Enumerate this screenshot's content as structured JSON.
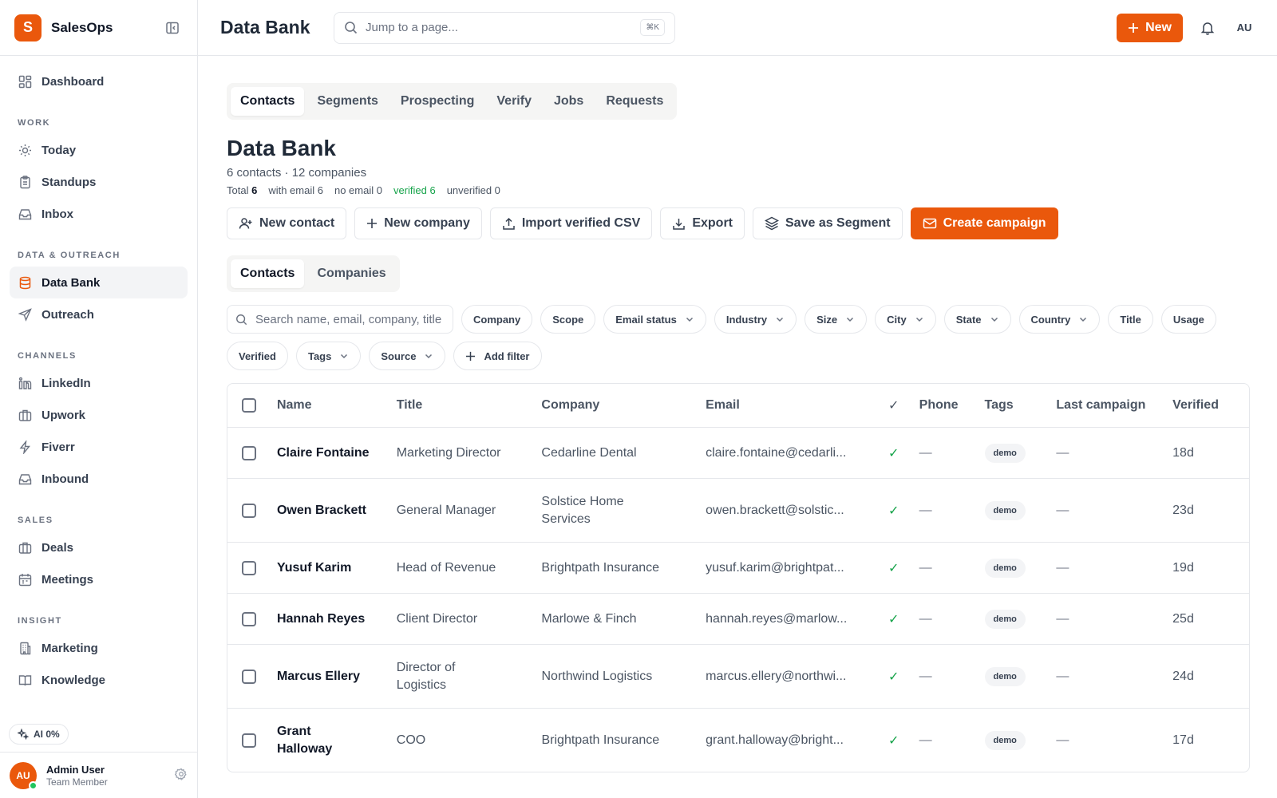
{
  "brand": {
    "logo_letter": "S",
    "name": "SalesOps"
  },
  "sidebar": {
    "top": [
      {
        "label": "Dashboard",
        "icon": "dashboard-icon"
      }
    ],
    "sections": [
      {
        "title": "WORK",
        "items": [
          {
            "label": "Today",
            "icon": "sun-icon"
          },
          {
            "label": "Standups",
            "icon": "clipboard-icon"
          },
          {
            "label": "Inbox",
            "icon": "inbox-icon"
          }
        ]
      },
      {
        "title": "DATA & OUTREACH",
        "items": [
          {
            "label": "Data Bank",
            "icon": "database-icon",
            "active": true
          },
          {
            "label": "Outreach",
            "icon": "send-icon"
          }
        ]
      },
      {
        "title": "CHANNELS",
        "items": [
          {
            "label": "LinkedIn",
            "icon": "linkedin-icon"
          },
          {
            "label": "Upwork",
            "icon": "briefcase-icon"
          },
          {
            "label": "Fiverr",
            "icon": "bolt-icon"
          },
          {
            "label": "Inbound",
            "icon": "inbox-icon"
          }
        ]
      },
      {
        "title": "SALES",
        "items": [
          {
            "label": "Deals",
            "icon": "briefcase-icon"
          },
          {
            "label": "Meetings",
            "icon": "calendar-icon"
          }
        ]
      },
      {
        "title": "INSIGHT",
        "items": [
          {
            "label": "Marketing",
            "icon": "building-icon"
          },
          {
            "label": "Knowledge",
            "icon": "book-icon"
          }
        ]
      }
    ],
    "ai_chip": "AI 0%",
    "user": {
      "initials": "AU",
      "name": "Admin User",
      "role": "Team Member"
    }
  },
  "topbar": {
    "title": "Data Bank",
    "search_placeholder": "Jump to a page...",
    "shortcut": "⌘K",
    "new_label": "New",
    "avatar": "AU"
  },
  "main": {
    "tabs": [
      "Contacts",
      "Segments",
      "Prospecting",
      "Verify",
      "Jobs",
      "Requests"
    ],
    "active_tab": "Contacts",
    "title": "Data Bank",
    "subtitle": "6 contacts · 12 companies",
    "stats": {
      "total_label": "Total",
      "total": "6",
      "with_email": "with email 6",
      "no_email": "no email 0",
      "verified": "verified 6",
      "unverified": "unverified 0"
    },
    "actions": {
      "new_contact": "New contact",
      "new_company": "New company",
      "import_csv": "Import verified CSV",
      "export": "Export",
      "save_segment": "Save as Segment",
      "create_campaign": "Create campaign"
    },
    "subtabs": [
      "Contacts",
      "Companies"
    ],
    "search_placeholder": "Search name, email, company, title",
    "filters_row1": [
      {
        "label": "Company",
        "dropdown": false
      },
      {
        "label": "Scope",
        "dropdown": false
      },
      {
        "label": "Email status",
        "dropdown": true
      },
      {
        "label": "Industry",
        "dropdown": true
      },
      {
        "label": "Size",
        "dropdown": true
      },
      {
        "label": "City",
        "dropdown": true
      },
      {
        "label": "State",
        "dropdown": true
      },
      {
        "label": "Country",
        "dropdown": true
      },
      {
        "label": "Title",
        "dropdown": false
      }
    ],
    "filters_row2": [
      {
        "label": "Usage",
        "dropdown": false
      },
      {
        "label": "Verified",
        "dropdown": false
      },
      {
        "label": "Tags",
        "dropdown": true
      },
      {
        "label": "Source",
        "dropdown": true
      }
    ],
    "add_filter": "Add filter",
    "table": {
      "headers": {
        "name": "Name",
        "title": "Title",
        "company": "Company",
        "email": "Email",
        "verified_mark": "✓",
        "phone": "Phone",
        "tags": "Tags",
        "last_campaign": "Last campaign",
        "verified": "Verified"
      },
      "rows": [
        {
          "name": "Claire Fontaine",
          "title": "Marketing Director",
          "company": "Cedarline Dental",
          "email": "claire.fontaine@cedarli...",
          "check": "✓",
          "phone": "—",
          "tag": "demo",
          "last": "—",
          "verified": "18d"
        },
        {
          "name": "Owen Brackett",
          "title": "General Manager",
          "company": "Solstice Home Services",
          "email": "owen.brackett@solstic...",
          "check": "✓",
          "phone": "—",
          "tag": "demo",
          "last": "—",
          "verified": "23d"
        },
        {
          "name": "Yusuf Karim",
          "title": "Head of Revenue",
          "company": "Brightpath Insurance",
          "email": "yusuf.karim@brightpat...",
          "check": "✓",
          "phone": "—",
          "tag": "demo",
          "last": "—",
          "verified": "19d"
        },
        {
          "name": "Hannah Reyes",
          "title": "Client Director",
          "company": "Marlowe & Finch",
          "email": "hannah.reyes@marlow...",
          "check": "✓",
          "phone": "—",
          "tag": "demo",
          "last": "—",
          "verified": "25d"
        },
        {
          "name": "Marcus Ellery",
          "title": "Director of Logistics",
          "company": "Northwind Logistics",
          "email": "marcus.ellery@northwi...",
          "check": "✓",
          "phone": "—",
          "tag": "demo",
          "last": "—",
          "verified": "24d"
        },
        {
          "name": "Grant Halloway",
          "title": "COO",
          "company": "Brightpath Insurance",
          "email": "grant.halloway@bright...",
          "check": "✓",
          "phone": "—",
          "tag": "demo",
          "last": "—",
          "verified": "17d"
        }
      ]
    }
  }
}
